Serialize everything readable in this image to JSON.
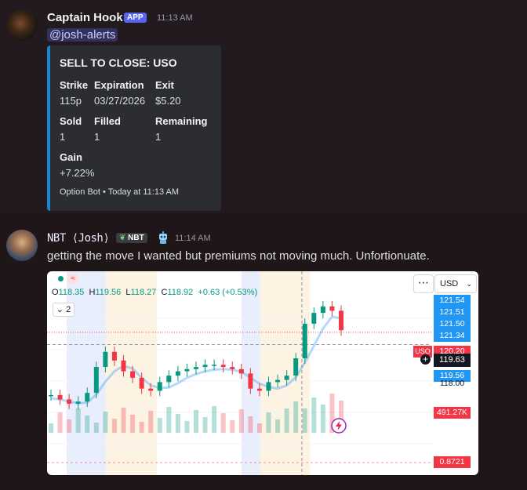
{
  "message1": {
    "author": "Captain Hook",
    "badge": "APP",
    "time": "11:13 AM",
    "mention": "@josh-alerts",
    "embed": {
      "title": "SELL TO CLOSE: USO",
      "fields": [
        {
          "label": "Strike",
          "value": "115p"
        },
        {
          "label": "Expiration",
          "value": "03/27/2026"
        },
        {
          "label": "Exit",
          "value": "$5.20"
        },
        {
          "label": "Sold",
          "value": "1"
        },
        {
          "label": "Filled",
          "value": "1"
        },
        {
          "label": "Remaining",
          "value": "1"
        },
        {
          "label": "Gain",
          "value": "+7.22%"
        }
      ],
      "footer": "Option Bot • Today at 11:13 AM",
      "accent_color": "#1a86d1"
    }
  },
  "message2": {
    "author": "NBT ⟨Josh⟩",
    "badge": "NBT",
    "bot_icon": "robot-icon",
    "time": "11:14 AM",
    "text": "getting the move I wanted but premiums not moving much. Unfortionuate.",
    "chart": {
      "ohlc": {
        "o_label": "O",
        "o": "118.35",
        "h_label": "H",
        "h": "119.56",
        "l_label": "L",
        "l": "118.27",
        "c_label": "C",
        "c": "118.92",
        "change": "+0.63 (+0.53%)"
      },
      "interval": "2",
      "interval_icon": "chevron-down-icon",
      "more_icon": "⋯",
      "currency": "USD",
      "price_labels": {
        "p1": "121.54",
        "p2": "121.51",
        "p3": "121.50",
        "p4": "121.34",
        "symbol": "USO",
        "p_red": "120.20",
        "current": "119.63",
        "p_low": "119.56",
        "p_118": "118.00",
        "volume": "491.27K",
        "indicator": "0.8721"
      }
    }
  },
  "chart_data": {
    "type": "candlestick",
    "title": "",
    "xlabel": "",
    "ylabel": "",
    "ylim": [
      116.5,
      122.3
    ],
    "symbol": "USO",
    "current_price": 119.63,
    "values": [
      117.3,
      117.1,
      116.9,
      117.0,
      117.4,
      118.6,
      119.3,
      118.9,
      118.4,
      118.1,
      117.6,
      117.5,
      117.9,
      118.2,
      118.4,
      118.5,
      118.6,
      118.7,
      118.7,
      118.6,
      118.5,
      118.3,
      117.6,
      117.5,
      117.9,
      118.0,
      118.2,
      119.0,
      120.6,
      121.1,
      121.4,
      121.2,
      120.3
    ],
    "colors": {
      "up": "#089981",
      "down": "#f23645",
      "ma": "#2196f3"
    }
  }
}
